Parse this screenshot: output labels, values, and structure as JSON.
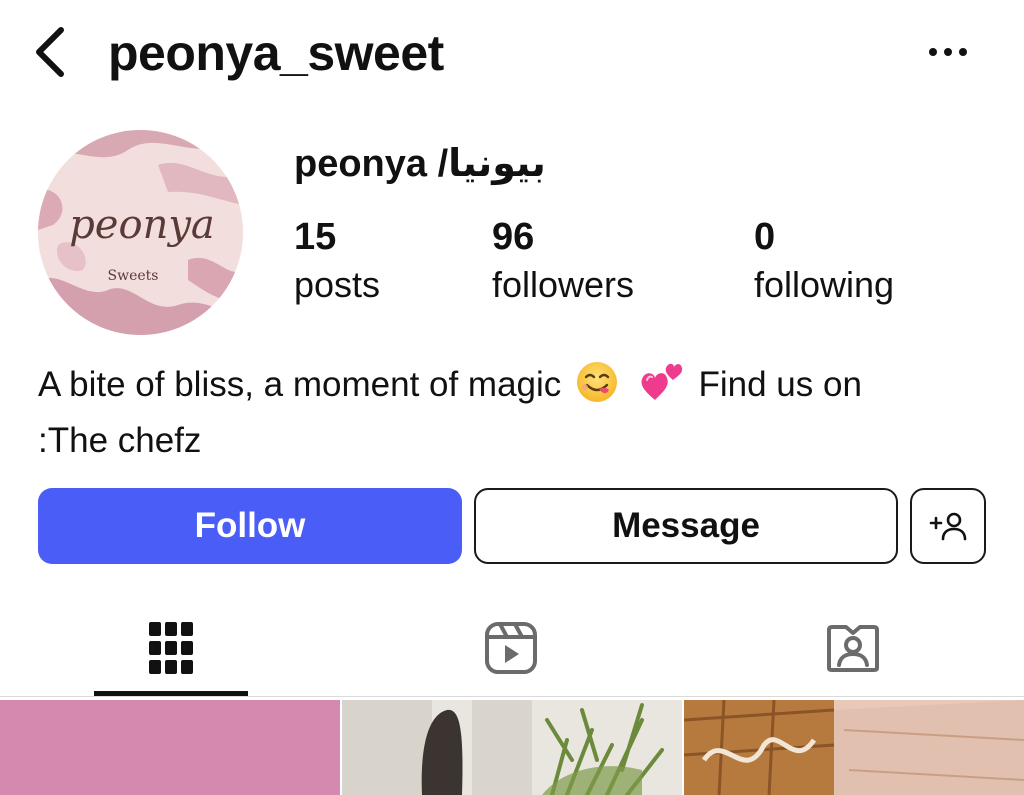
{
  "header": {
    "username": "peonya_sweet",
    "back_icon": "chevron-left-icon",
    "more_icon": "more-horizontal-icon"
  },
  "profile": {
    "display_name": "peonya /بيونيا",
    "avatar": {
      "logo_text": "peonya",
      "logo_subtext": "Sweets"
    },
    "stats": {
      "posts_count": "15",
      "posts_label": "posts",
      "followers_count": "96",
      "followers_label": "followers",
      "following_count": "0",
      "following_label": "following"
    },
    "bio": {
      "text_before_emoji": "A bite of bliss, a moment of magic",
      "emojis": [
        "face-savoring-food-emoji",
        "two-hearts-emoji"
      ],
      "text_after_emoji": "Find us on :The chefz"
    }
  },
  "actions": {
    "follow_label": "Follow",
    "message_label": "Message",
    "suggest_icon": "add-person-icon",
    "follow_color": "#4a5ef7"
  },
  "tabs": [
    {
      "icon": "grid-icon",
      "active": true
    },
    {
      "icon": "reels-icon",
      "active": false
    },
    {
      "icon": "tagged-icon",
      "active": false
    }
  ],
  "posts": [
    {
      "thumbnail": "pink-background"
    },
    {
      "thumbnail": "plant-and-figure"
    },
    {
      "thumbnail": "pastry-tray"
    }
  ]
}
